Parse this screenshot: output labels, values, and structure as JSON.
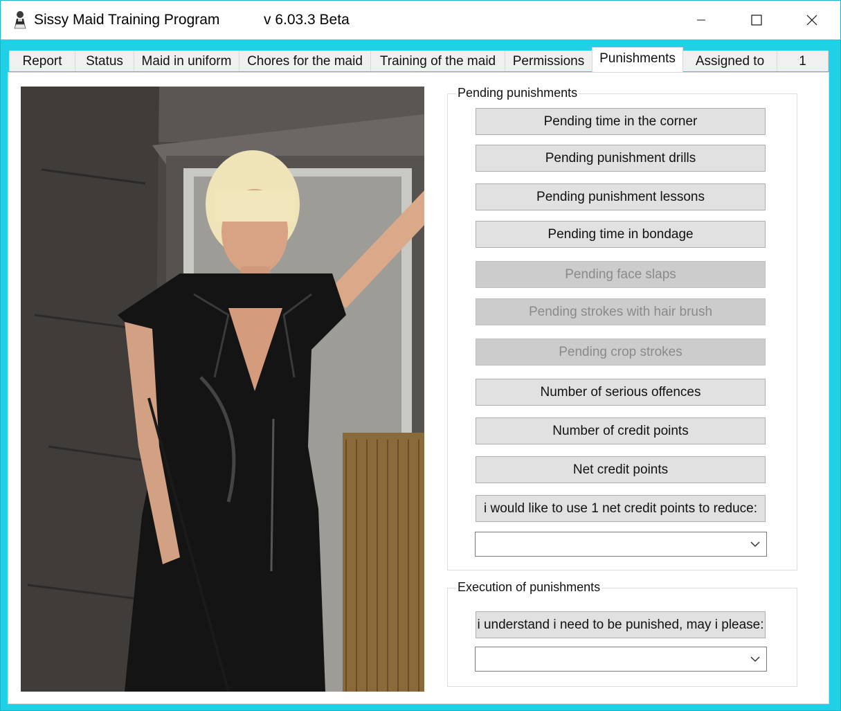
{
  "window": {
    "title": "Sissy Maid Training Program",
    "version": "v 6.03.3 Beta"
  },
  "tabs": [
    {
      "label": "Report"
    },
    {
      "label": "Status"
    },
    {
      "label": "Maid in uniform"
    },
    {
      "label": "Chores for the maid"
    },
    {
      "label": "Training of the maid"
    },
    {
      "label": "Permissions"
    },
    {
      "label": "Punishments",
      "active": true
    },
    {
      "label": "Assigned to"
    },
    {
      "label": "1"
    }
  ],
  "pending": {
    "title": "Pending punishments",
    "buttons": [
      {
        "label": "Pending time in the corner",
        "enabled": true
      },
      {
        "label": "Pending punishment drills",
        "enabled": true
      },
      {
        "label": "Pending punishment lessons",
        "enabled": true
      },
      {
        "label": "Pending time in bondage",
        "enabled": true
      },
      {
        "label": "Pending face slaps",
        "enabled": false
      },
      {
        "label": "Pending strokes with hair brush",
        "enabled": false
      },
      {
        "label": "Pending crop strokes",
        "enabled": false
      },
      {
        "label": "Number of serious offences",
        "enabled": true
      },
      {
        "label": "Number of credit points",
        "enabled": true
      },
      {
        "label": "Net credit points",
        "enabled": true
      },
      {
        "label": "i would like to use 1 net credit points to reduce:",
        "enabled": true
      }
    ],
    "reduce_select": ""
  },
  "execution": {
    "title": "Execution of punishments",
    "button": "i understand i need to be punished, may i please:",
    "select": ""
  },
  "colors": {
    "frame": "#20d0e4",
    "button_face": "#e1e1e1",
    "button_disabled": "#cccccc"
  }
}
